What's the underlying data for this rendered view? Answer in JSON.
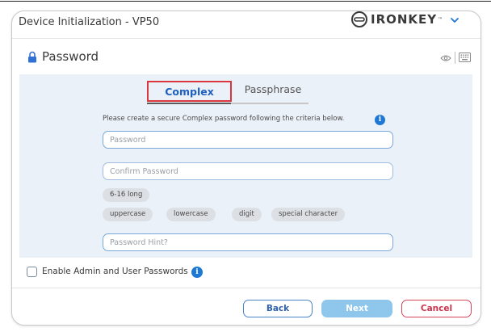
{
  "window": {
    "title": "Device Initialization - VP50",
    "brand": "IRONKEY",
    "brand_mark": "™"
  },
  "section": {
    "title": "Password",
    "icon": "lock-icon"
  },
  "tabs": [
    {
      "label": "Complex",
      "active": true
    },
    {
      "label": "Passphrase",
      "active": false
    }
  ],
  "form": {
    "instruction": "Please create a secure Complex password following the criteria below.",
    "password_placeholder": "Password",
    "confirm_placeholder": "Confirm Password",
    "hint_placeholder": "Password Hint?",
    "criteria": [
      "6-16 long",
      "uppercase",
      "lowercase",
      "digit",
      "special character"
    ]
  },
  "options": {
    "enable_admin_user_label": "Enable Admin and User Passwords",
    "enable_admin_user_checked": false
  },
  "buttons": {
    "back": "Back",
    "next": "Next",
    "cancel": "Cancel"
  },
  "colors": {
    "accent": "#1e78d6",
    "active_tab_highlight": "#d9363e",
    "cancel": "#d6455c",
    "next_disabled": "#8ec6ec",
    "panel_bg": "#ebf1f8"
  }
}
